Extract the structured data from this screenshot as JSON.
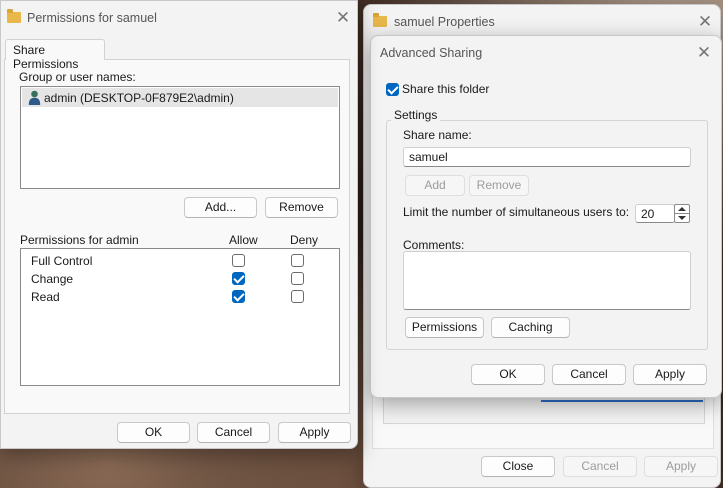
{
  "permissions_dialog": {
    "title": "Permissions for samuel",
    "tab": "Share Permissions",
    "group_label": "Group or user names:",
    "users": [
      {
        "name": "admin (DESKTOP-0F879E2\\admin)"
      }
    ],
    "add_label": "Add...",
    "remove_label": "Remove",
    "perm_header": "Permissions for admin",
    "allow_header": "Allow",
    "deny_header": "Deny",
    "permissions": [
      {
        "name": "Full Control",
        "allow": false,
        "deny": false
      },
      {
        "name": "Change",
        "allow": true,
        "deny": false
      },
      {
        "name": "Read",
        "allow": true,
        "deny": false
      }
    ],
    "ok_label": "OK",
    "cancel_label": "Cancel",
    "apply_label": "Apply"
  },
  "properties_window": {
    "title": "samuel Properties",
    "close_label": "Close",
    "cancel_label": "Cancel",
    "apply_label": "Apply"
  },
  "advanced_sharing": {
    "title": "Advanced Sharing",
    "share_folder_label": "Share this folder",
    "share_folder_checked": true,
    "settings_label": "Settings",
    "share_name_label": "Share name:",
    "share_name_value": "samuel",
    "add_label": "Add",
    "remove_label": "Remove",
    "limit_label": "Limit the number of simultaneous users to:",
    "limit_value": "20",
    "comments_label": "Comments:",
    "comments_value": "",
    "permissions_label": "Permissions",
    "caching_label": "Caching",
    "ok_label": "OK",
    "cancel_label": "Cancel",
    "apply_label": "Apply"
  },
  "icons": {
    "folder": "folder-icon",
    "close": "close-icon",
    "user": "user-icon"
  },
  "colors": {
    "accent": "#0067c0",
    "window_bg": "#f3f3f3",
    "selection": "#e5e5e5"
  }
}
